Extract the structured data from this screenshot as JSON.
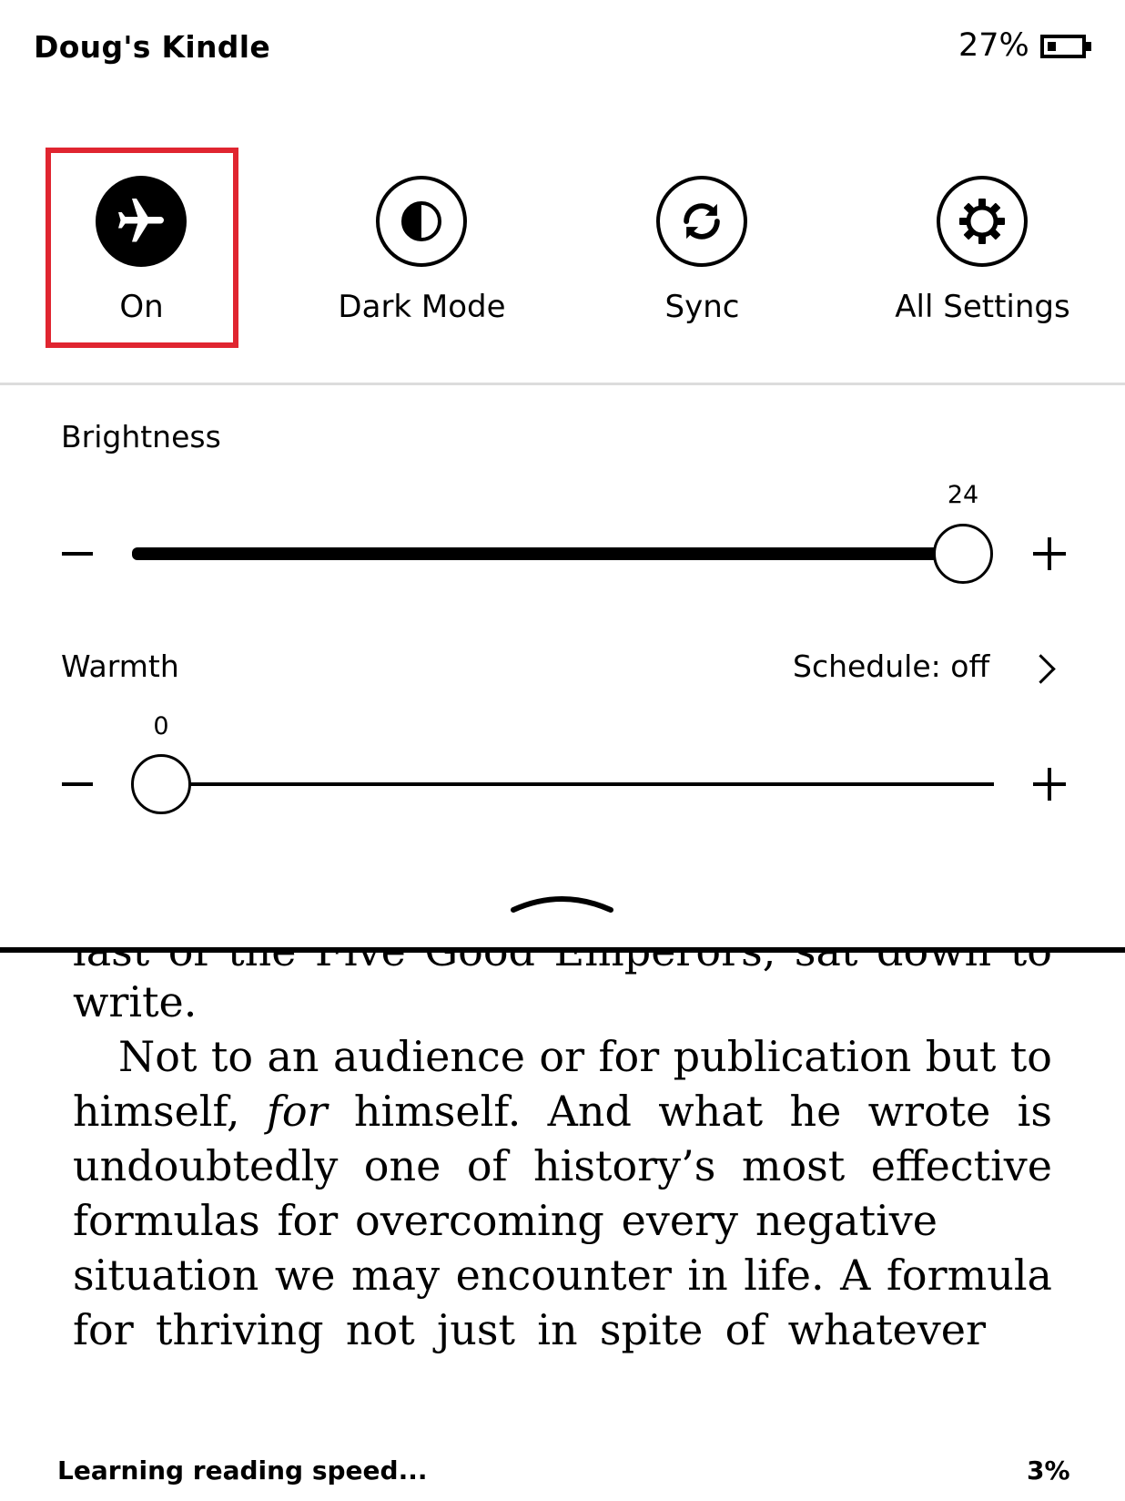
{
  "header": {
    "device_name": "Doug's Kindle",
    "battery_percent": "27%",
    "battery_level": 0.27
  },
  "quick_actions": [
    {
      "label": "On",
      "icon": "airplane-icon",
      "active": true
    },
    {
      "label": "Dark Mode",
      "icon": "contrast-icon",
      "active": false
    },
    {
      "label": "Sync",
      "icon": "sync-icon",
      "active": false
    },
    {
      "label": "All Settings",
      "icon": "gear-icon",
      "active": false
    }
  ],
  "brightness": {
    "label": "Brightness",
    "value": "24",
    "min_symbol": "−",
    "max_symbol": "+"
  },
  "warmth": {
    "label": "Warmth",
    "value": "0",
    "schedule": "Schedule: off"
  },
  "book": {
    "lines": [
      [
        "last",
        "of",
        "the",
        "Five",
        "Good",
        "Emperors,",
        "sat",
        "down",
        "to"
      ],
      [
        "write."
      ],
      [
        "Not",
        "to",
        "an",
        "audience",
        "or",
        "for",
        "publication",
        "but",
        "to"
      ],
      [
        "himself,",
        "for",
        "himself.",
        "And",
        "what",
        "he",
        "wrote",
        "is"
      ],
      [
        "undoubtedly",
        "one",
        "of",
        "history’s",
        "most",
        "effective"
      ],
      [
        "formulas",
        "for",
        "overcoming",
        "every",
        "negative"
      ],
      [
        "situation",
        "we",
        "may",
        "encounter",
        "in",
        "life.",
        "A",
        "formula"
      ],
      [
        "for",
        "thriving",
        "not",
        "just",
        "in",
        "spite",
        "of",
        "whatever"
      ]
    ]
  },
  "footer": {
    "status": "Learning reading speed...",
    "progress": "3%"
  },
  "colors": {
    "highlight": "#e02530",
    "divider": "#dcdcdc"
  }
}
